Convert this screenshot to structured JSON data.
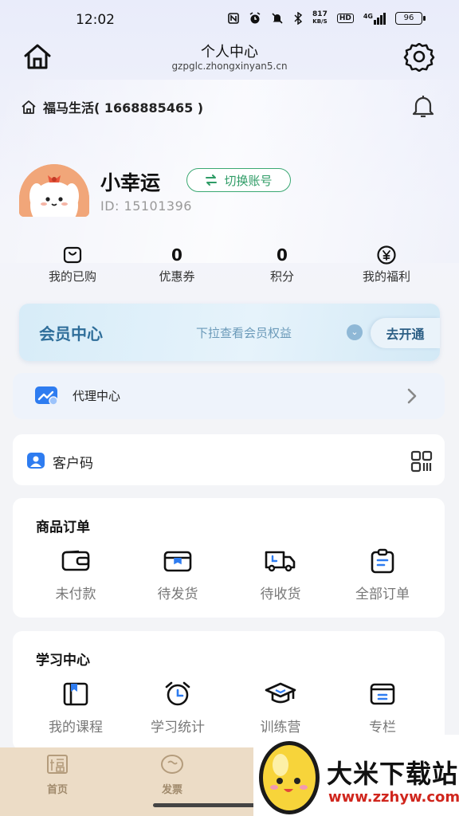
{
  "status_bar": {
    "time": "12:02",
    "net_speed_value": "817",
    "net_speed_unit": "KB/S",
    "hd": "HD",
    "signal": "4G",
    "battery": "96"
  },
  "header": {
    "title": "个人中心",
    "url": "gzpglc.zhongxinyan5.cn"
  },
  "shop": {
    "name": "福马生活( 1668885465 )"
  },
  "profile": {
    "username": "小幸运",
    "switch_label": "切换账号",
    "user_id": "ID: 15101396"
  },
  "stats": [
    {
      "value": "",
      "label": "我的已购",
      "icon": "bag-icon"
    },
    {
      "value": "0",
      "label": "优惠券"
    },
    {
      "value": "0",
      "label": "积分"
    },
    {
      "value": "",
      "label": "我的福利",
      "icon": "yen-icon"
    }
  ],
  "member": {
    "title": "会员中心",
    "hint": "下拉查看会员权益",
    "button": "去开通"
  },
  "agent": {
    "label": "代理中心"
  },
  "customer_code": {
    "label": "客户码"
  },
  "orders": {
    "title": "商品订单",
    "items": [
      {
        "label": "未付款",
        "icon": "wallet-icon"
      },
      {
        "label": "待发货",
        "icon": "package-icon"
      },
      {
        "label": "待收货",
        "icon": "truck-icon"
      },
      {
        "label": "全部订单",
        "icon": "clipboard-icon"
      }
    ]
  },
  "study": {
    "title": "学习中心",
    "items": [
      {
        "label": "我的课程",
        "icon": "book-icon"
      },
      {
        "label": "学习统计",
        "icon": "alarm-clock-icon"
      },
      {
        "label": "训练营",
        "icon": "graduation-cap-icon"
      },
      {
        "label": "专栏",
        "icon": "column-card-icon"
      }
    ]
  },
  "bottom_nav": [
    {
      "label": "首页",
      "icon": "fu-icon"
    },
    {
      "label": "发票",
      "icon": "invoice-icon"
    }
  ],
  "watermark": {
    "title": "大米下载站",
    "url": "www.zzhyw.com"
  },
  "colors": {
    "accent_green": "#2f9c66",
    "member_blue": "#2f6e9a",
    "nav_bg": "#ecdcc6",
    "watermark_red": "#d0261d"
  }
}
